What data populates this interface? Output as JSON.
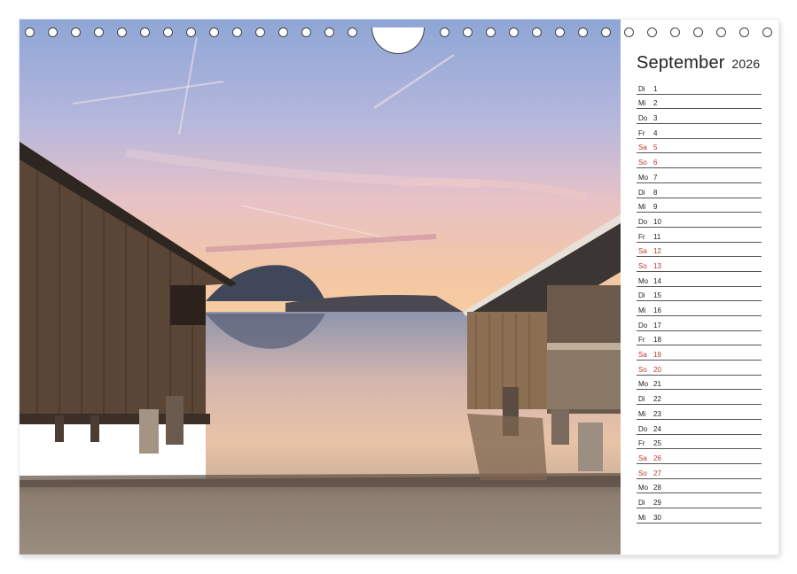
{
  "calendar": {
    "month": "September",
    "year": "2026",
    "days": [
      {
        "wd": "Di",
        "n": "1"
      },
      {
        "wd": "Mi",
        "n": "2"
      },
      {
        "wd": "Do",
        "n": "3"
      },
      {
        "wd": "Fr",
        "n": "4"
      },
      {
        "wd": "Sa",
        "n": "5"
      },
      {
        "wd": "So",
        "n": "6"
      },
      {
        "wd": "Mo",
        "n": "7"
      },
      {
        "wd": "Di",
        "n": "8"
      },
      {
        "wd": "Mi",
        "n": "9"
      },
      {
        "wd": "Do",
        "n": "10"
      },
      {
        "wd": "Fr",
        "n": "11"
      },
      {
        "wd": "Sa",
        "n": "12"
      },
      {
        "wd": "So",
        "n": "13"
      },
      {
        "wd": "Mo",
        "n": "14"
      },
      {
        "wd": "Di",
        "n": "15"
      },
      {
        "wd": "Mi",
        "n": "16"
      },
      {
        "wd": "Do",
        "n": "17"
      },
      {
        "wd": "Fr",
        "n": "18"
      },
      {
        "wd": "Sa",
        "n": "19"
      },
      {
        "wd": "So",
        "n": "20"
      },
      {
        "wd": "Mo",
        "n": "21"
      },
      {
        "wd": "Di",
        "n": "22"
      },
      {
        "wd": "Mi",
        "n": "23"
      },
      {
        "wd": "Do",
        "n": "24"
      },
      {
        "wd": "Fr",
        "n": "25"
      },
      {
        "wd": "Sa",
        "n": "26"
      },
      {
        "wd": "So",
        "n": "27"
      },
      {
        "wd": "Mo",
        "n": "28"
      },
      {
        "wd": "Di",
        "n": "29"
      },
      {
        "wd": "Mi",
        "n": "30"
      }
    ],
    "weekend_color": "#b83a2b",
    "text_color": "#222222"
  },
  "binding": {
    "hole_count_left": 15,
    "hole_count_right": 15
  }
}
